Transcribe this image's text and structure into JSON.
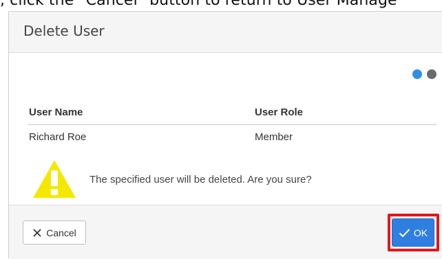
{
  "top_instruction": ", click the \"Cancel\" button to return to User Manage",
  "dialog": {
    "title": "Delete User",
    "steps": [
      {
        "state": "active",
        "color": "#2f8fe8"
      },
      {
        "state": "inactive",
        "color": "#6b6b6b"
      }
    ],
    "table": {
      "headers": [
        "User Name",
        "User Role"
      ],
      "rows": [
        [
          "Richard Roe",
          "Member"
        ]
      ]
    },
    "warning": {
      "icon": "warning-icon",
      "text": "The specified user will be deleted. Are you sure?"
    },
    "footer": {
      "cancel": {
        "icon": "close-icon",
        "label": "Cancel"
      },
      "ok": {
        "icon": "check-icon",
        "label": "OK"
      }
    }
  },
  "colors": {
    "primary": "#2f7fe0",
    "highlight": "#e3161b",
    "warning": "#f5e800"
  }
}
